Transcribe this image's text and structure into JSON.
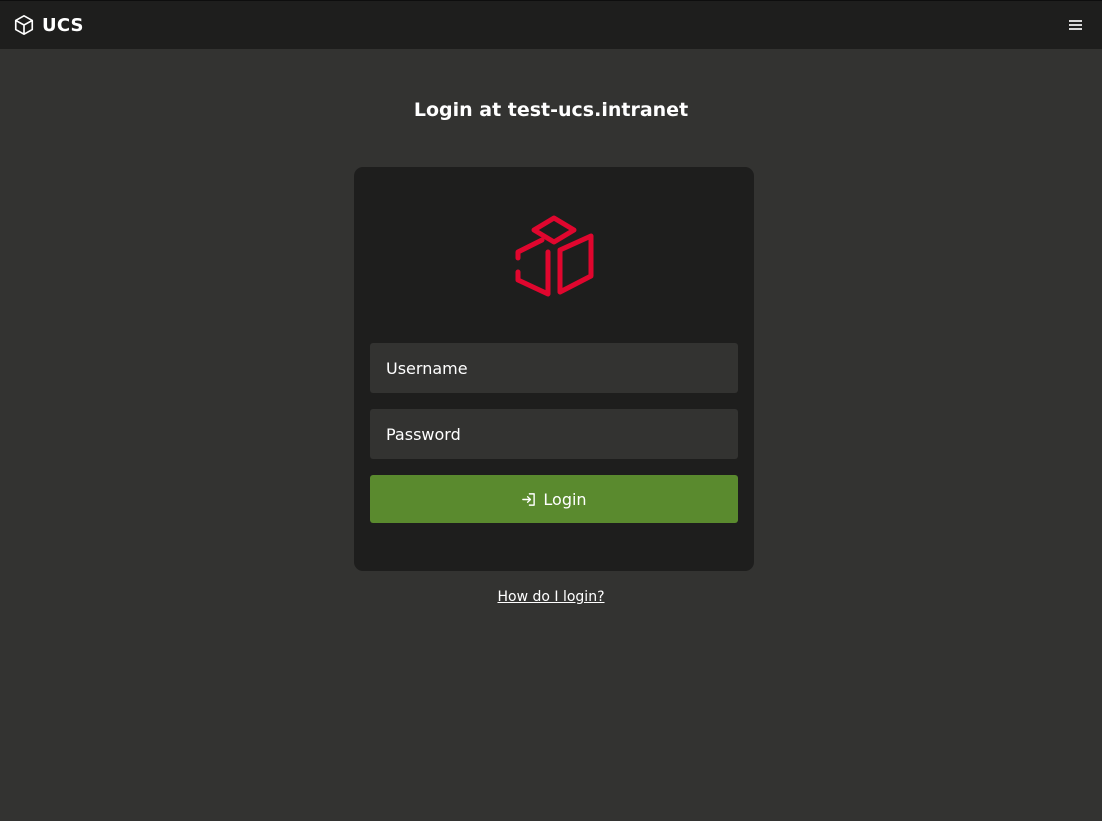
{
  "topbar": {
    "brand_name": "UCS",
    "brand_icon": "cube-icon",
    "menu_icon": "hamburger-menu-icon"
  },
  "page": {
    "title": "Login at test-ucs.intranet"
  },
  "login_form": {
    "logo_icon": "cube-logo-icon",
    "logo_color": "#e0062e",
    "username": {
      "placeholder": "Username",
      "value": ""
    },
    "password": {
      "placeholder": "Password",
      "value": ""
    },
    "submit_label": "Login",
    "submit_icon": "login-arrow-icon",
    "submit_color": "#5a8a2e"
  },
  "help": {
    "link_text": "How do I login?"
  }
}
